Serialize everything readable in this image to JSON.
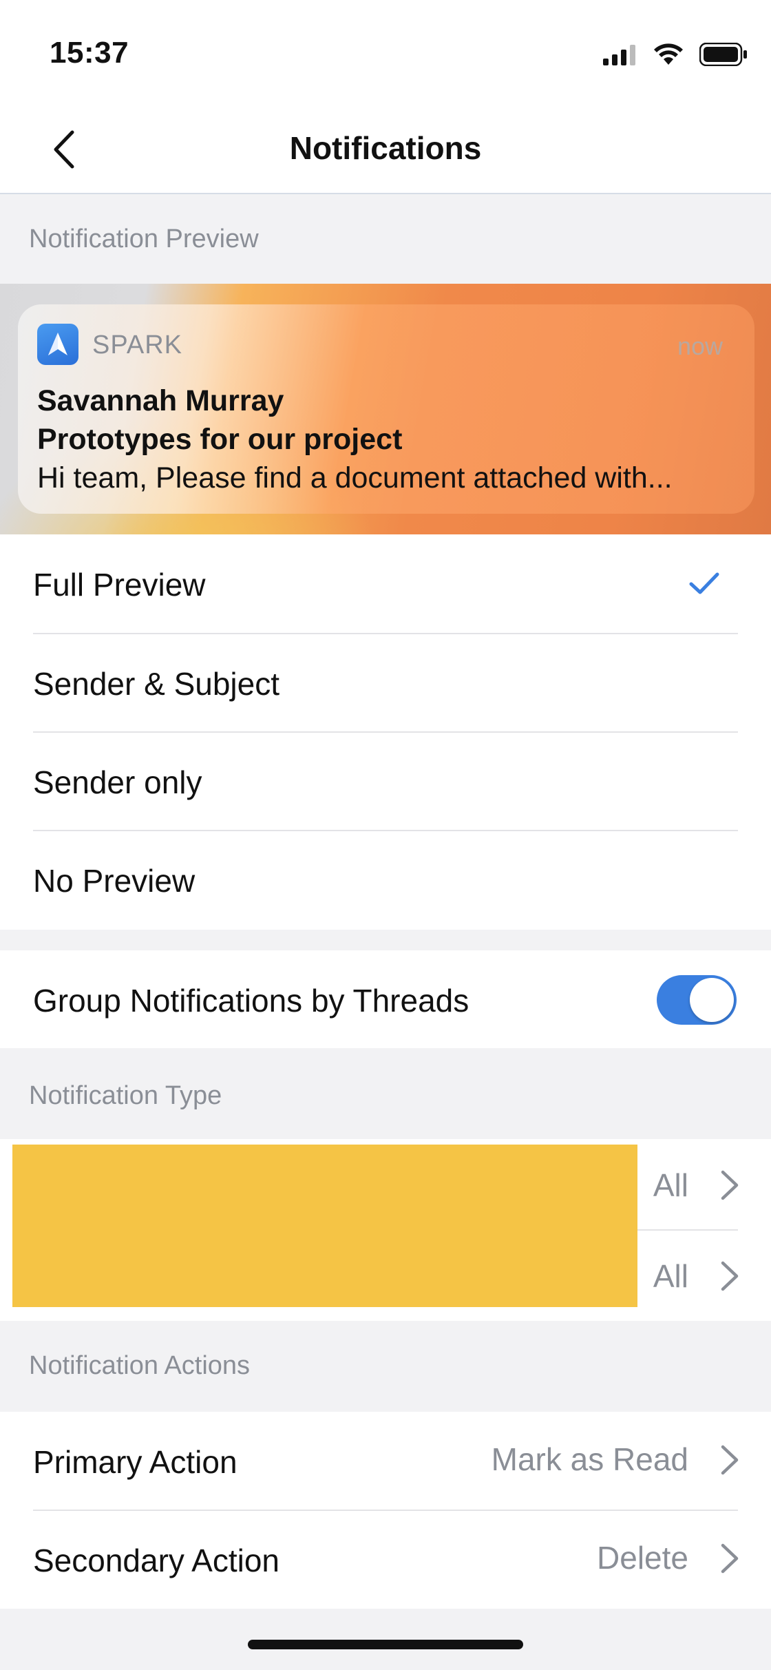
{
  "status_bar": {
    "time": "15:37"
  },
  "nav": {
    "title": "Notifications"
  },
  "sections": {
    "preview": "Notification Preview",
    "type": "Notification Type",
    "actions": "Notification Actions"
  },
  "notification": {
    "app_name": "SPARK",
    "time": "now",
    "sender": "Savannah Murray",
    "subject": "Prototypes for our project",
    "body": "Hi team, Please find a document attached with..."
  },
  "preview_options": [
    {
      "label": "Full Preview",
      "selected": true
    },
    {
      "label": "Sender & Subject",
      "selected": false
    },
    {
      "label": "Sender only",
      "selected": false
    },
    {
      "label": "No Preview",
      "selected": false
    }
  ],
  "group_threads": {
    "label": "Group Notifications by Threads",
    "enabled": true
  },
  "notification_types": [
    {
      "value": "All"
    },
    {
      "value": "All"
    }
  ],
  "actions": [
    {
      "label": "Primary Action",
      "value": "Mark as Read"
    },
    {
      "label": "Secondary Action",
      "value": "Delete"
    }
  ],
  "colors": {
    "accent": "#3a7fe0",
    "redaction": "#f5c445"
  }
}
